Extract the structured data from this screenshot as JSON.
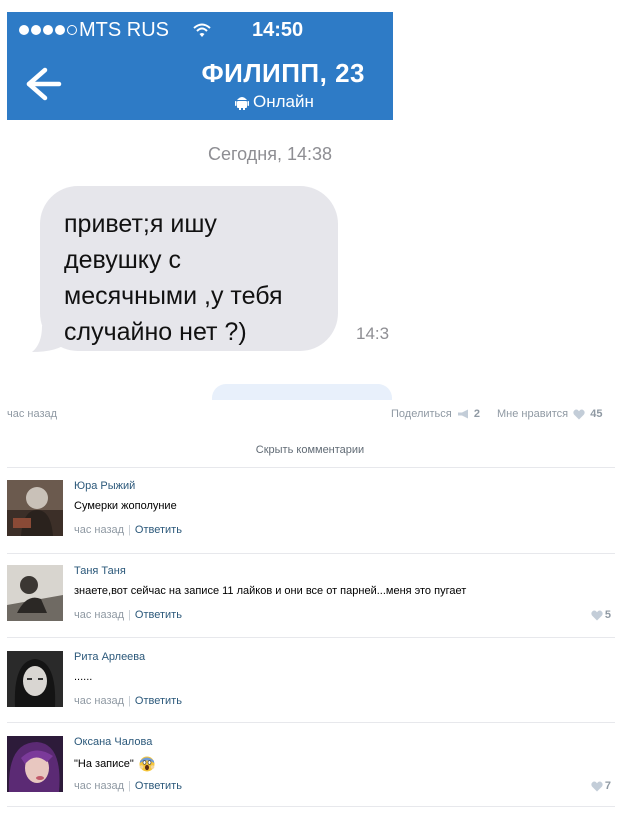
{
  "status_bar": {
    "carrier": "MTS RUS",
    "time": "14:50",
    "signal_icon": "signal-dots-icon",
    "wifi_icon": "wifi-icon"
  },
  "chat_header": {
    "contact_name": "ФИЛИПП, 23",
    "status": "Онлайн",
    "back_icon": "arrow-left-icon",
    "platform_icon": "android-icon",
    "color": "#2e7bc6"
  },
  "chat": {
    "date_separator": "Сегодня, 14:38",
    "message": {
      "text": "привет;я ишу\nдевушку с\nмесячными ,у тебя\nслучайно нет ?)",
      "time": "14:3"
    }
  },
  "post_meta": {
    "time": "час назад",
    "share_label": "Поделиться",
    "share_count": "2",
    "like_label": "Мне нравится",
    "like_count": "45"
  },
  "hide_comments_label": "Скрыть комментарии",
  "comments": [
    {
      "author": "Юра Рыжий",
      "text": "Сумерки жополуние",
      "time": "час назад",
      "reply_label": "Ответить",
      "likes": ""
    },
    {
      "author": "Таня Таня",
      "text": "знаете,вот сейчас на записе 11 лайков и они все от парней...меня это пугает",
      "time": "час назад",
      "reply_label": "Ответить",
      "likes": "5"
    },
    {
      "author": "Рита Арлеева",
      "text": "......",
      "time": "час назад",
      "reply_label": "Ответить",
      "likes": ""
    },
    {
      "author": "Оксана Чалова",
      "text": "\"На записе\"",
      "emoji": "screaming-face-emoji",
      "time": "час назад",
      "reply_label": "Ответить",
      "likes": "7"
    }
  ],
  "colors": {
    "link": "#2b587a",
    "muted": "#8f99a3",
    "bubble": "#e6e6eb"
  }
}
